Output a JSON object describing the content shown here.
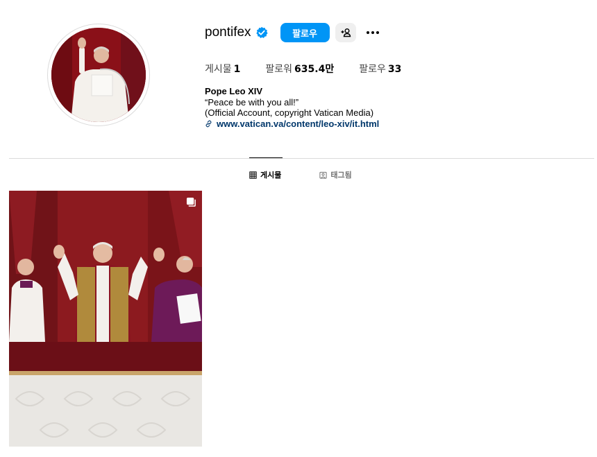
{
  "profile": {
    "username": "pontifex",
    "follow_label": "팔로우",
    "stats": [
      {
        "label": "게시물",
        "value": "1"
      },
      {
        "label": "팔로워",
        "value": "635.4만"
      },
      {
        "label": "팔로우",
        "value": "33"
      }
    ],
    "bio": {
      "name": "Pope Leo XIV",
      "line1": "“Peace be with you all!”",
      "line2": "(Official Account, copyright Vatican Media)",
      "link": "www.vatican.va/content/leo-xiv/it.html"
    }
  },
  "tabs": [
    {
      "label": "게시물",
      "active": true
    },
    {
      "label": "태그됨",
      "active": false
    }
  ],
  "colors": {
    "follow_button": "#0095f6",
    "link": "#00376b",
    "verified_badge": "#0095f6"
  },
  "icons": [
    "verified-badge-icon",
    "add-person-icon",
    "more-options-icon",
    "link-icon",
    "grid-icon",
    "tagged-icon",
    "carousel-icon"
  ]
}
